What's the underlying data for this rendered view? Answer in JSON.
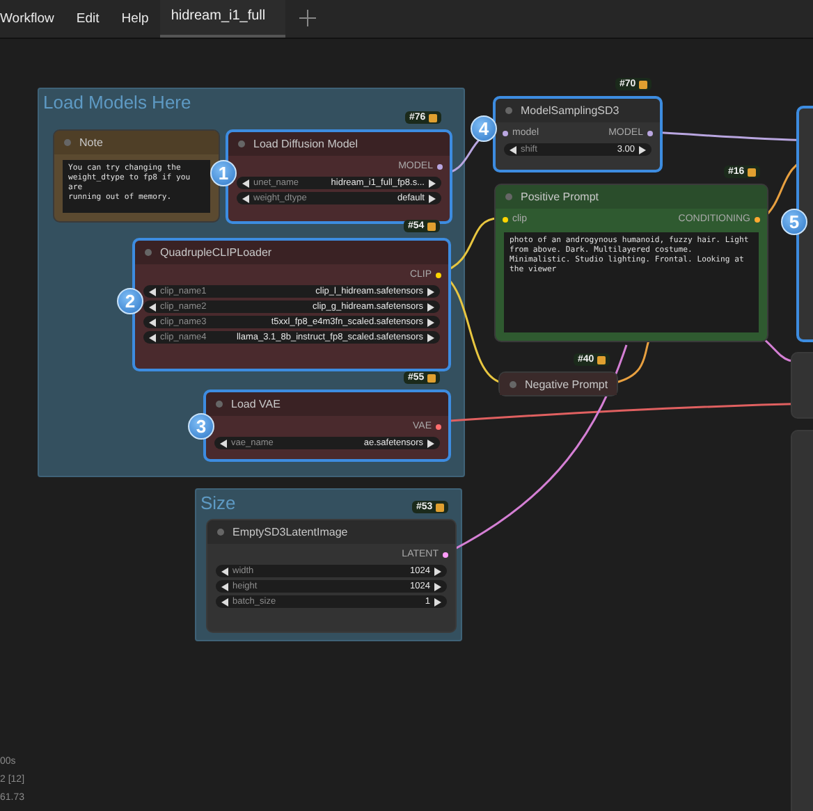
{
  "menu": [
    "Workflow",
    "Edit",
    "Help"
  ],
  "tabs": [
    {
      "label": "hidream_i1_full",
      "selected": true
    }
  ],
  "groups": [
    {
      "title": "Load Models Here"
    },
    {
      "title": "Size"
    }
  ],
  "nodes": [
    {
      "kind": "note",
      "title": "Note",
      "selected": false,
      "body": "You can try changing the\nweight_dtype to fp8 if you are\nrunning out of memory."
    },
    {
      "kind": "loader",
      "title": "Load Diffusion Model",
      "selected": true,
      "badge": "#76",
      "step": "1",
      "outputs": [
        {
          "name": "MODEL",
          "color": "#b9a6e0"
        }
      ],
      "widgets": [
        {
          "label": "unet_name",
          "value": "hidream_i1_full_fp8.s..."
        },
        {
          "label": "weight_dtype",
          "value": "default"
        }
      ]
    },
    {
      "kind": "loader",
      "title": "QuadrupleCLIPLoader",
      "selected": true,
      "badge": "#54",
      "step": "2",
      "outputs": [
        {
          "name": "CLIP",
          "color": "#ffd500"
        }
      ],
      "widgets": [
        {
          "label": "clip_name1",
          "value": "clip_l_hidream.safetensors"
        },
        {
          "label": "clip_name2",
          "value": "clip_g_hidream.safetensors"
        },
        {
          "label": "clip_name3",
          "value": "t5xxl_fp8_e4m3fn_scaled.safetensors"
        },
        {
          "label": "clip_name4",
          "value": "llama_3.1_8b_instruct_fp8_scaled.safetensors"
        }
      ]
    },
    {
      "kind": "loader",
      "title": "Load VAE",
      "selected": true,
      "badge": "#55",
      "step": "3",
      "outputs": [
        {
          "name": "VAE",
          "color": "#ff6e6e"
        }
      ],
      "widgets": [
        {
          "label": "vae_name",
          "value": "ae.safetensors"
        }
      ]
    },
    {
      "kind": "plain",
      "title": "EmptySD3LatentImage",
      "selected": false,
      "badge": "#53",
      "outputs": [
        {
          "name": "LATENT",
          "color": "#ff9cf9"
        }
      ],
      "widgets": [
        {
          "label": "width",
          "value": "1024"
        },
        {
          "label": "height",
          "value": "1024"
        },
        {
          "label": "batch_size",
          "value": "1"
        }
      ]
    },
    {
      "kind": "plain",
      "title": "ModelSamplingSD3",
      "selected": true,
      "badge": "#70",
      "step": "4",
      "inputs": [
        {
          "name": "model",
          "color": "#b9a6e0"
        }
      ],
      "outputs": [
        {
          "name": "MODEL",
          "color": "#b9a6e0"
        }
      ],
      "widgets": [
        {
          "label": "shift",
          "value": "3.00"
        }
      ]
    },
    {
      "kind": "prompt",
      "title": "Positive Prompt",
      "selected": false,
      "badge": "#16",
      "inputs": [
        {
          "name": "clip",
          "color": "#ffd500"
        }
      ],
      "outputs": [
        {
          "name": "CONDITIONING",
          "color": "#ffa931"
        }
      ],
      "body": "photo of an androgynous humanoid, fuzzy hair. Light from above. Dark. Multilayered costume. Minimalistic. Studio lighting. Frontal. Looking at the viewer"
    },
    {
      "kind": "collapsed",
      "title": "Negative Prompt",
      "selected": false,
      "badge": "#40"
    },
    {
      "kind": "plain",
      "selected": true,
      "step": "5"
    },
    {
      "kind": "plain",
      "selected": false
    },
    {
      "kind": "plain",
      "selected": false
    }
  ],
  "stats": [
    "00s",
    "2 [12]",
    "61.73"
  ]
}
